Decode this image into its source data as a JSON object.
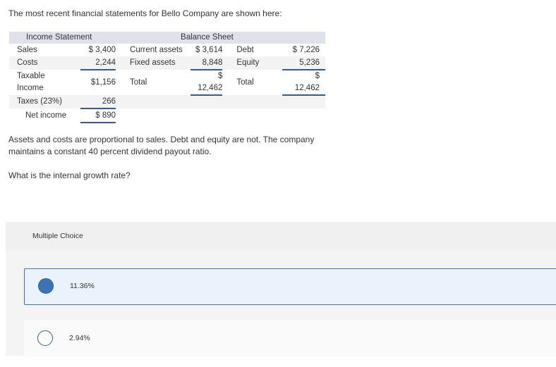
{
  "intro": "The most recent financial statements for Bello Company are shown here:",
  "table": {
    "income_header": "Income Statement",
    "balance_header": "Balance Sheet",
    "rows": [
      {
        "l1": "Sales",
        "v1": "$ 3,400",
        "l2": "Current assets",
        "v2": "$ 3,614",
        "l3": "Debt",
        "v3": "$ 7,226"
      },
      {
        "l1": "Costs",
        "v1": "2,244",
        "l2": "Fixed assets",
        "v2": "8,848",
        "l3": "Equity",
        "v3": "5,236"
      },
      {
        "l1a": "Taxable",
        "l1b": "Income",
        "v1": "$1,156",
        "l2": "Total",
        "v2a": "$",
        "v2b": "12,462",
        "l3": "Total",
        "v3a": "$",
        "v3b": "12,462"
      },
      {
        "l1": "Taxes (23%)",
        "v1": "266"
      },
      {
        "l1": "Net income",
        "v1": "$ 890"
      }
    ]
  },
  "paragraph1_line1": "Assets and costs are proportional to sales. Debt and equity are not. The company",
  "paragraph1_line2": "maintains a constant 40 percent dividend payout ratio.",
  "question": "What is the internal growth rate?",
  "multiple_choice": {
    "header": "Multiple Choice",
    "options": [
      {
        "label": "11.36%",
        "selected": true
      },
      {
        "label": "2.94%",
        "selected": false
      }
    ]
  },
  "colors": {
    "accent": "#3a74b5",
    "selected_bg": "#eaf2fb",
    "table_header_bg": "#dfe2ea",
    "underline": "#2f5e8e"
  }
}
